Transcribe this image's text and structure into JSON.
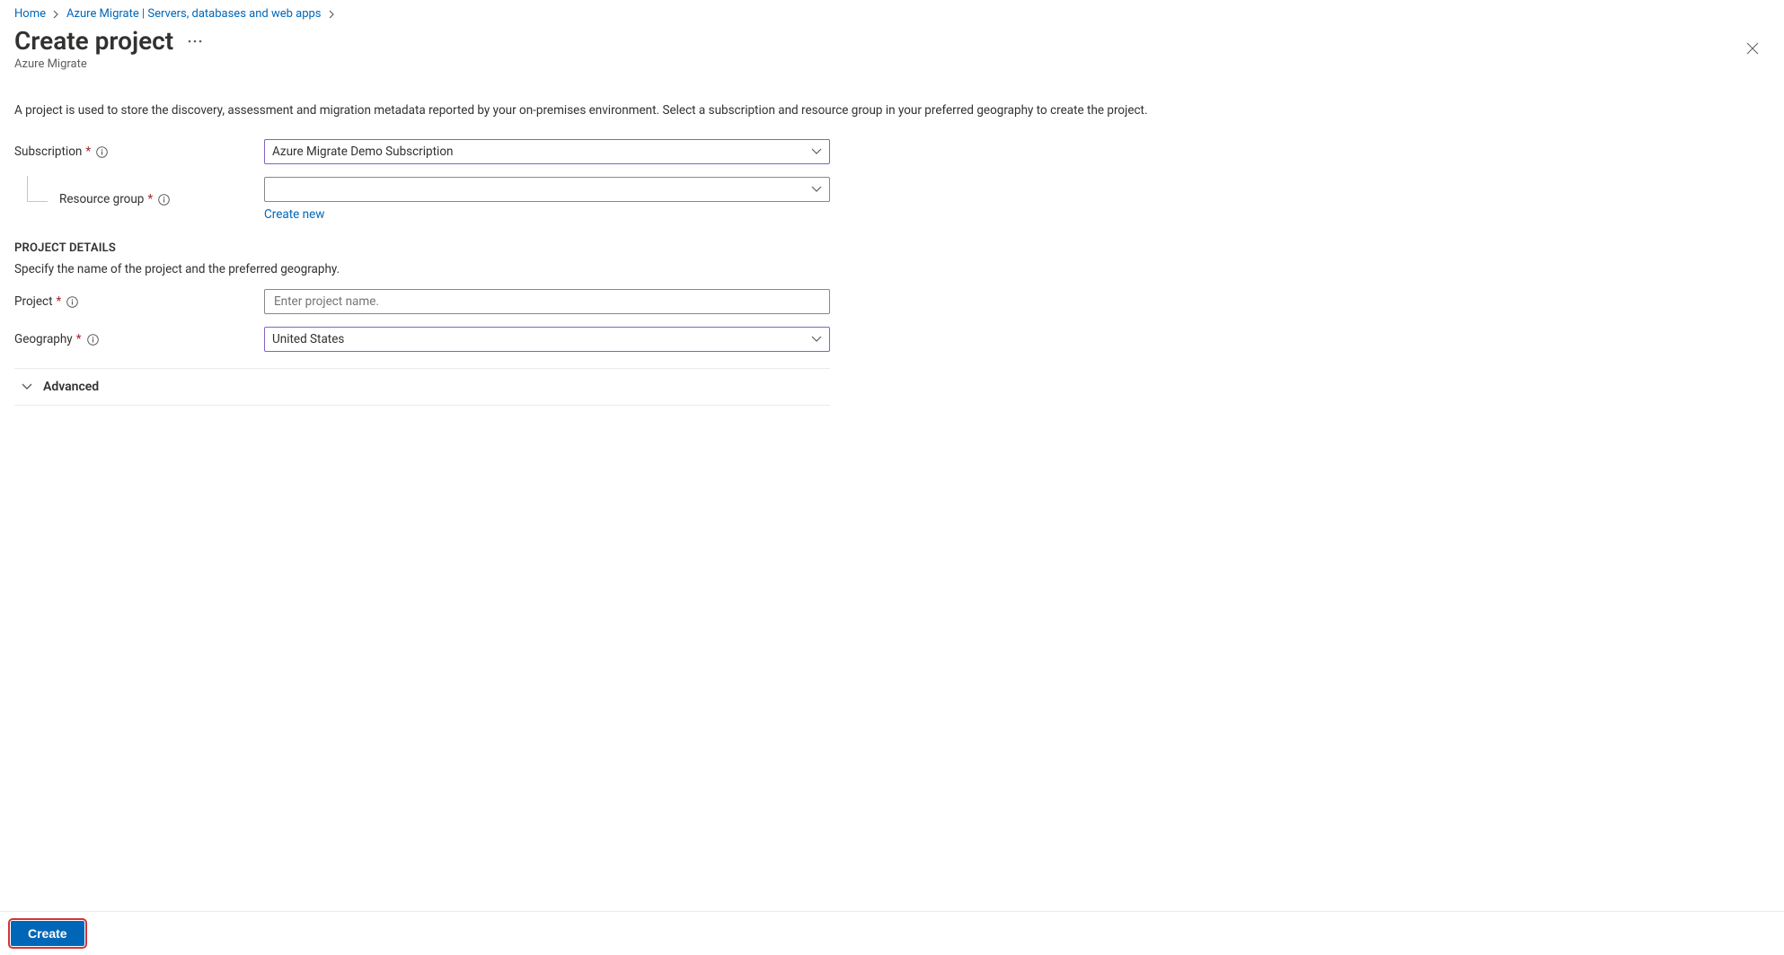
{
  "breadcrumb": {
    "items": [
      "Home",
      "Azure Migrate | Servers, databases and web apps"
    ]
  },
  "header": {
    "title": "Create project",
    "subtitle": "Azure Migrate"
  },
  "description": "A project is used to store the discovery, assessment and migration metadata reported by your on-premises environment. Select a subscription and resource group in your preferred geography to create the project.",
  "fields": {
    "subscription": {
      "label": "Subscription",
      "value": "Azure Migrate Demo Subscription"
    },
    "resource_group": {
      "label": "Resource group",
      "value": "",
      "create_new": "Create new"
    },
    "project": {
      "label": "Project",
      "placeholder": "Enter project name."
    },
    "geography": {
      "label": "Geography",
      "value": "United States"
    }
  },
  "section": {
    "heading": "PROJECT DETAILS",
    "desc": "Specify the name of the project and the preferred geography."
  },
  "advanced": {
    "label": "Advanced"
  },
  "footer": {
    "create": "Create"
  }
}
